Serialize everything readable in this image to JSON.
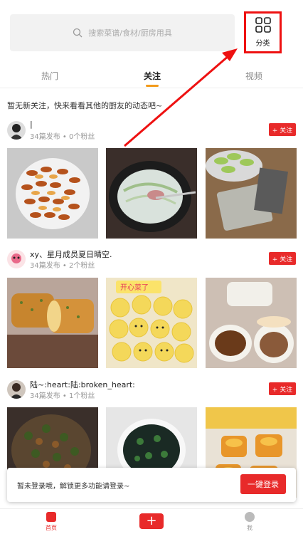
{
  "search": {
    "placeholder": "搜索菜谱/食材/厨房用具"
  },
  "category": {
    "label": "分类"
  },
  "tabs": {
    "hot": "热门",
    "follow": "关注",
    "video": "视频"
  },
  "notice": "暂无新关注，快来看看其他的厨友的动态吧~",
  "users": [
    {
      "name": "|",
      "posts": "34篇发布",
      "fans": "0个粉丝",
      "follow": "+ 关注"
    },
    {
      "name": "xy、星月成员夏日晴空.",
      "posts": "34篇发布",
      "fans": "2个粉丝",
      "follow": "+ 关注"
    },
    {
      "name": "陆~:heart:陆:broken_heart:",
      "posts": "34篇发布",
      "fans": "1个粉丝",
      "follow": "+ 关注"
    }
  ],
  "photo_text": {
    "smile_caption": "开心菜了"
  },
  "banner": {
    "message": "暂未登录哦，解锁更多功能请登录~",
    "login": "一键登录"
  },
  "tabbar": {
    "home": "首页",
    "add": "+",
    "me": "我"
  },
  "colors": {
    "accent": "#e82a2a",
    "tab_underline": "#f39a1b",
    "highlight_box": "#ee1111"
  }
}
